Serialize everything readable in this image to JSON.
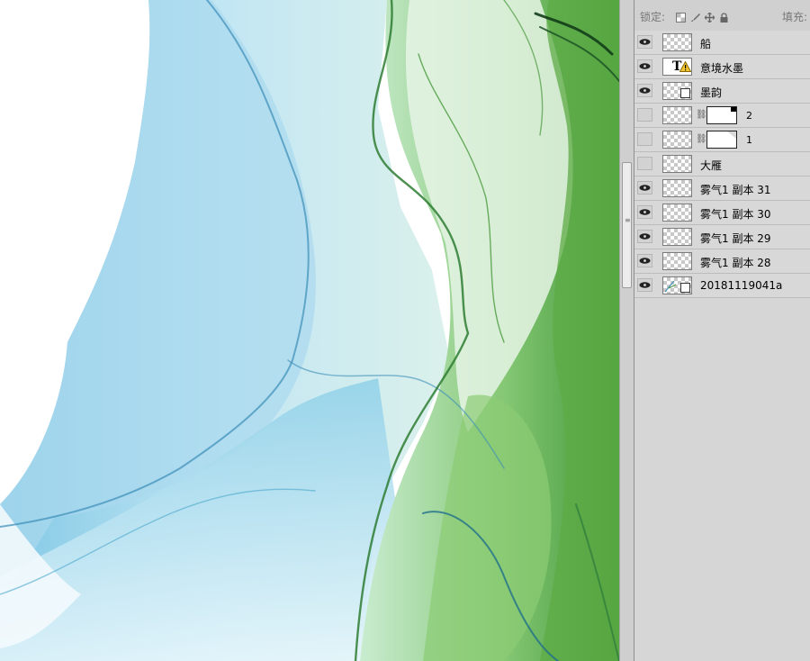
{
  "panel": {
    "lock_label": "锁定:",
    "fill_label": "填充:",
    "lock_icons": [
      "lock-transparent-icon",
      "lock-paint-icon",
      "lock-position-icon",
      "lock-all-icon"
    ]
  },
  "layers": [
    {
      "name": "船",
      "visible": true,
      "kind": "raster"
    },
    {
      "name": "意境水墨",
      "visible": true,
      "kind": "text-warning"
    },
    {
      "name": "墨韵",
      "visible": true,
      "kind": "smart-object"
    },
    {
      "name": "2",
      "visible": false,
      "kind": "masked"
    },
    {
      "name": "1",
      "visible": false,
      "kind": "masked"
    },
    {
      "name": "大雁",
      "visible": false,
      "kind": "raster"
    },
    {
      "name": "雾气1 副本 31",
      "visible": true,
      "kind": "raster"
    },
    {
      "name": "雾气1 副本 30",
      "visible": true,
      "kind": "raster"
    },
    {
      "name": "雾气1 副本 29",
      "visible": true,
      "kind": "raster"
    },
    {
      "name": "雾气1 副本 28",
      "visible": true,
      "kind": "raster"
    },
    {
      "name": "20181119041a",
      "visible": true,
      "kind": "smart-object"
    }
  ],
  "canvas": {
    "colors": {
      "blue": "#4aa6cc",
      "light_blue": "#bfe3f1",
      "green": "#4f9e3a",
      "dark_green": "#1f5e2a"
    }
  }
}
